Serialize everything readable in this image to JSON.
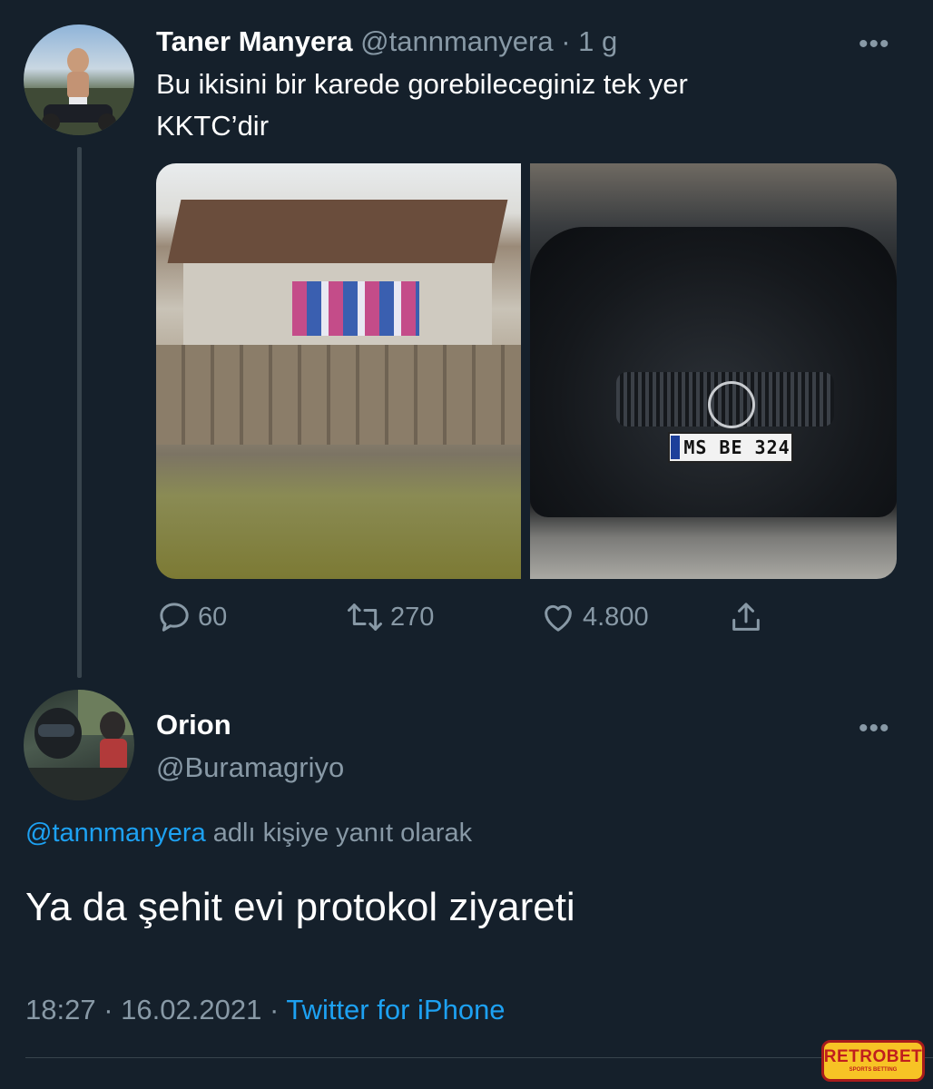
{
  "parent_tweet": {
    "author_name": "Taner Manyera",
    "author_handle": "@tannmanyera",
    "separator": "·",
    "time_ago": "1 g",
    "text_line1": "Bu ikisini bir karede gorebileceginiz tek yer",
    "text_line2": "KKTC’dir",
    "media": {
      "left_description_icon": "house-photo",
      "right_plate_text": "MS BE 324"
    },
    "actions": {
      "reply_count": "60",
      "retweet_count": "270",
      "like_count": "4.800"
    }
  },
  "reply_tweet": {
    "author_name": "Orion",
    "author_handle": "@Buramagriyo",
    "reply_to_mention": "@tannmanyera",
    "reply_to_suffix": "adlı kişiye yanıt olarak",
    "text": "Ya da şehit evi protokol ziyareti",
    "time": "18:27",
    "dot": "·",
    "date": "16.02.2021",
    "dot2": "·",
    "source": "Twitter for iPhone"
  },
  "more_label": "•••",
  "watermark": {
    "main": "RETROBET",
    "sub": "SPORTS BETTING"
  },
  "colors": {
    "background": "#15202b",
    "secondary_text": "#8899a6",
    "link": "#1da1f2",
    "divider": "#38444d"
  }
}
